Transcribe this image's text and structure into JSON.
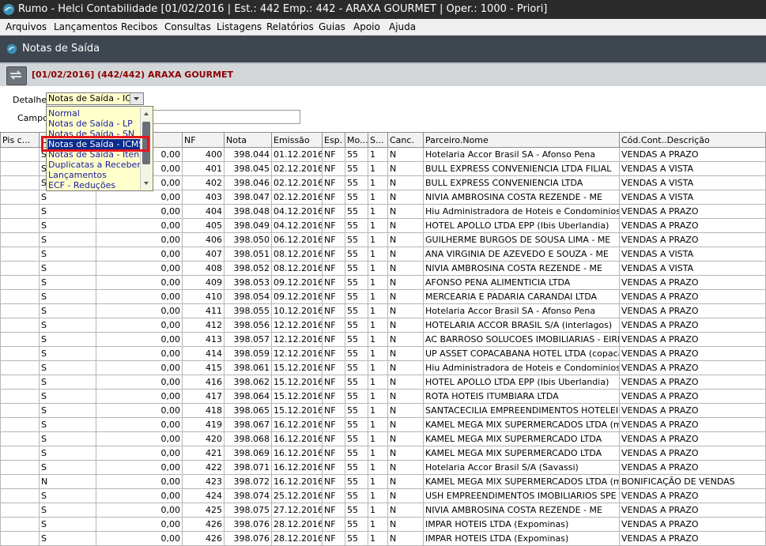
{
  "window": {
    "title": "Rumo - Helci Contabilidade [01/02/2016 | Est.: 442 Emp.: 442 - ARAXA GOURMET | Oper.: 1000 - Priori]"
  },
  "menu": [
    "Arquivos",
    "Lançamentos",
    "Recibos",
    "Consultas",
    "Listagens",
    "Relatórios",
    "Guias",
    "Apoio",
    "Ajuda"
  ],
  "child_window": {
    "title": "Notas de Saída"
  },
  "header": {
    "text": "[01/02/2016] (442/442) ARAXA GOURMET"
  },
  "detalhe": {
    "label": "Detalhe",
    "value": "Notas de Saída - ICMS"
  },
  "campo": {
    "label": "Campo",
    "value": ""
  },
  "dropdown": {
    "items": [
      "Normal",
      "Notas de Saída - LP",
      "Notas de Saída - SN",
      "Notas de Saída - ICMS",
      "Notas de Saída - Itens",
      "Duplicatas a Receber",
      "Lançamentos",
      "ECF - Reduções"
    ],
    "selected_index": 3,
    "highlight_color": "#e4151e"
  },
  "table": {
    "columns": [
      "Pis c...",
      "C",
      "",
      "NF",
      "Nota",
      "Emissão",
      "Esp.",
      "Mo...",
      "S...",
      "Canc.",
      "Parceiro.Nome",
      "Cód.Cont..Descrição"
    ],
    "rows": [
      [
        "",
        "S",
        "0,00",
        "400",
        "398.044",
        "01.12.2016",
        "NF",
        "55",
        "1",
        "N",
        "Hotelaria Accor Brasil SA - Afonso Pena",
        "VENDAS A PRAZO"
      ],
      [
        "",
        "S",
        "0,00",
        "401",
        "398.045",
        "02.12.2016",
        "NF",
        "55",
        "1",
        "N",
        "BULL EXPRESS CONVENIENCIA LTDA FILIAL",
        "VENDAS A VISTA"
      ],
      [
        "",
        "S",
        "0,00",
        "402",
        "398.046",
        "02.12.2016",
        "NF",
        "55",
        "1",
        "N",
        "BULL EXPRESS CONVENIENCIA LTDA",
        "VENDAS A VISTA"
      ],
      [
        "",
        "S",
        "0,00",
        "403",
        "398.047",
        "02.12.2016",
        "NF",
        "55",
        "1",
        "N",
        "NIVIA AMBROSINA COSTA REZENDE - ME",
        "VENDAS A VISTA"
      ],
      [
        "",
        "S",
        "0,00",
        "404",
        "398.048",
        "04.12.2016",
        "NF",
        "55",
        "1",
        "N",
        "Hiu Administradora de Hoteis e Condominios Ltda - 1",
        "VENDAS A PRAZO"
      ],
      [
        "",
        "S",
        "0,00",
        "405",
        "398.049",
        "04.12.2016",
        "NF",
        "55",
        "1",
        "N",
        "HOTEL APOLLO LTDA EPP (Ibis Uberlandia)",
        "VENDAS A PRAZO"
      ],
      [
        "",
        "S",
        "0,00",
        "406",
        "398.050",
        "06.12.2016",
        "NF",
        "55",
        "1",
        "N",
        "GUILHERME BURGOS DE SOUSA LIMA - ME",
        "VENDAS A PRAZO"
      ],
      [
        "",
        "S",
        "0,00",
        "407",
        "398.051",
        "08.12.2016",
        "NF",
        "55",
        "1",
        "N",
        "ANA VIRGINIA DE AZEVEDO E SOUZA - ME",
        "VENDAS A VISTA"
      ],
      [
        "",
        "S",
        "0,00",
        "408",
        "398.052",
        "08.12.2016",
        "NF",
        "55",
        "1",
        "N",
        "NIVIA AMBROSINA COSTA REZENDE - ME",
        "VENDAS A VISTA"
      ],
      [
        "",
        "S",
        "0,00",
        "409",
        "398.053",
        "09.12.2016",
        "NF",
        "55",
        "1",
        "N",
        "AFONSO PENA ALIMENTICIA LTDA",
        "VENDAS A PRAZO"
      ],
      [
        "",
        "S",
        "0,00",
        "410",
        "398.054",
        "09.12.2016",
        "NF",
        "55",
        "1",
        "N",
        "MERCEARIA E PADARIA CARANDAI LTDA",
        "VENDAS A PRAZO"
      ],
      [
        "",
        "S",
        "0,00",
        "411",
        "398.055",
        "10.12.2016",
        "NF",
        "55",
        "1",
        "N",
        "Hotelaria Accor Brasil SA - Afonso Pena",
        "VENDAS A PRAZO"
      ],
      [
        "",
        "S",
        "0,00",
        "412",
        "398.056",
        "12.12.2016",
        "NF",
        "55",
        "1",
        "N",
        "HOTELARIA ACCOR BRASIL S/A (interlagos)",
        "VENDAS A PRAZO"
      ],
      [
        "",
        "S",
        "0,00",
        "413",
        "398.057",
        "12.12.2016",
        "NF",
        "55",
        "1",
        "N",
        "AC BARROSO SOLUCOES IMOBILIARIAS - EIRELI - ",
        "VENDAS A PRAZO"
      ],
      [
        "",
        "S",
        "0,00",
        "414",
        "398.059",
        "12.12.2016",
        "NF",
        "55",
        "1",
        "N",
        "UP ASSET COPACABANA HOTEL LTDA (copacabana",
        "VENDAS A PRAZO"
      ],
      [
        "",
        "S",
        "0,00",
        "415",
        "398.061",
        "15.12.2016",
        "NF",
        "55",
        "1",
        "N",
        "Hiu Administradora de Hoteis e Condominios Ltda - 1",
        "VENDAS A PRAZO"
      ],
      [
        "",
        "S",
        "0,00",
        "416",
        "398.062",
        "15.12.2016",
        "NF",
        "55",
        "1",
        "N",
        "HOTEL APOLLO LTDA EPP (Ibis Uberlandia)",
        "VENDAS A PRAZO"
      ],
      [
        "",
        "S",
        "0,00",
        "417",
        "398.064",
        "15.12.2016",
        "NF",
        "55",
        "1",
        "N",
        "ROTA HOTEIS ITUMBIARA LTDA",
        "VENDAS A PRAZO"
      ],
      [
        "",
        "S",
        "0,00",
        "418",
        "398.065",
        "15.12.2016",
        "NF",
        "55",
        "1",
        "N",
        "SANTACECILIA EMPREENDIMENTOS HOTELEIROS L",
        "VENDAS A PRAZO"
      ],
      [
        "",
        "S",
        "0,00",
        "419",
        "398.067",
        "16.12.2016",
        "NF",
        "55",
        "1",
        "N",
        "KAMEL MEGA MIX SUPERMERCADOS LTDA (matriz)",
        "VENDAS A PRAZO"
      ],
      [
        "",
        "S",
        "0,00",
        "420",
        "398.068",
        "16.12.2016",
        "NF",
        "55",
        "1",
        "N",
        "KAMEL MEGA MIX SUPERMERCADO LTDA",
        "VENDAS A PRAZO"
      ],
      [
        "",
        "S",
        "0,00",
        "421",
        "398.069",
        "16.12.2016",
        "NF",
        "55",
        "1",
        "N",
        "KAMEL MEGA MIX SUPERMERCADO LTDA",
        "VENDAS A PRAZO"
      ],
      [
        "",
        "S",
        "0,00",
        "422",
        "398.071",
        "16.12.2016",
        "NF",
        "55",
        "1",
        "N",
        "Hotelaria Accor Brasil S/A (Savassi)",
        "VENDAS A PRAZO"
      ],
      [
        "",
        "N",
        "0,00",
        "423",
        "398.072",
        "16.12.2016",
        "NF",
        "55",
        "1",
        "N",
        "KAMEL MEGA MIX SUPERMERCADOS LTDA (matriz)",
        "BONIFICAÇÃO DE VENDAS"
      ],
      [
        "",
        "S",
        "0,00",
        "424",
        "398.074",
        "25.12.2016",
        "NF",
        "55",
        "1",
        "N",
        "USH EMPREENDIMENTOS IMOBILIARIOS SPE LTDA",
        "VENDAS A PRAZO"
      ],
      [
        "",
        "S",
        "0,00",
        "425",
        "398.075",
        "27.12.2016",
        "NF",
        "55",
        "1",
        "N",
        "NIVIA AMBROSINA COSTA REZENDE - ME",
        "VENDAS A PRAZO"
      ],
      [
        "",
        "S",
        "0,00",
        "426",
        "398.076",
        "28.12.2016",
        "NF",
        "55",
        "1",
        "N",
        "IMPAR HOTEIS LTDA (Expominas)",
        "VENDAS A PRAZO"
      ],
      [
        "",
        "S",
        "0,00",
        "426",
        "398.076",
        "28.12.2016",
        "NF",
        "55",
        "1",
        "N",
        "IMPAR HOTEIS LTDA (Expominas)",
        "VENDAS A PRAZO"
      ]
    ]
  }
}
